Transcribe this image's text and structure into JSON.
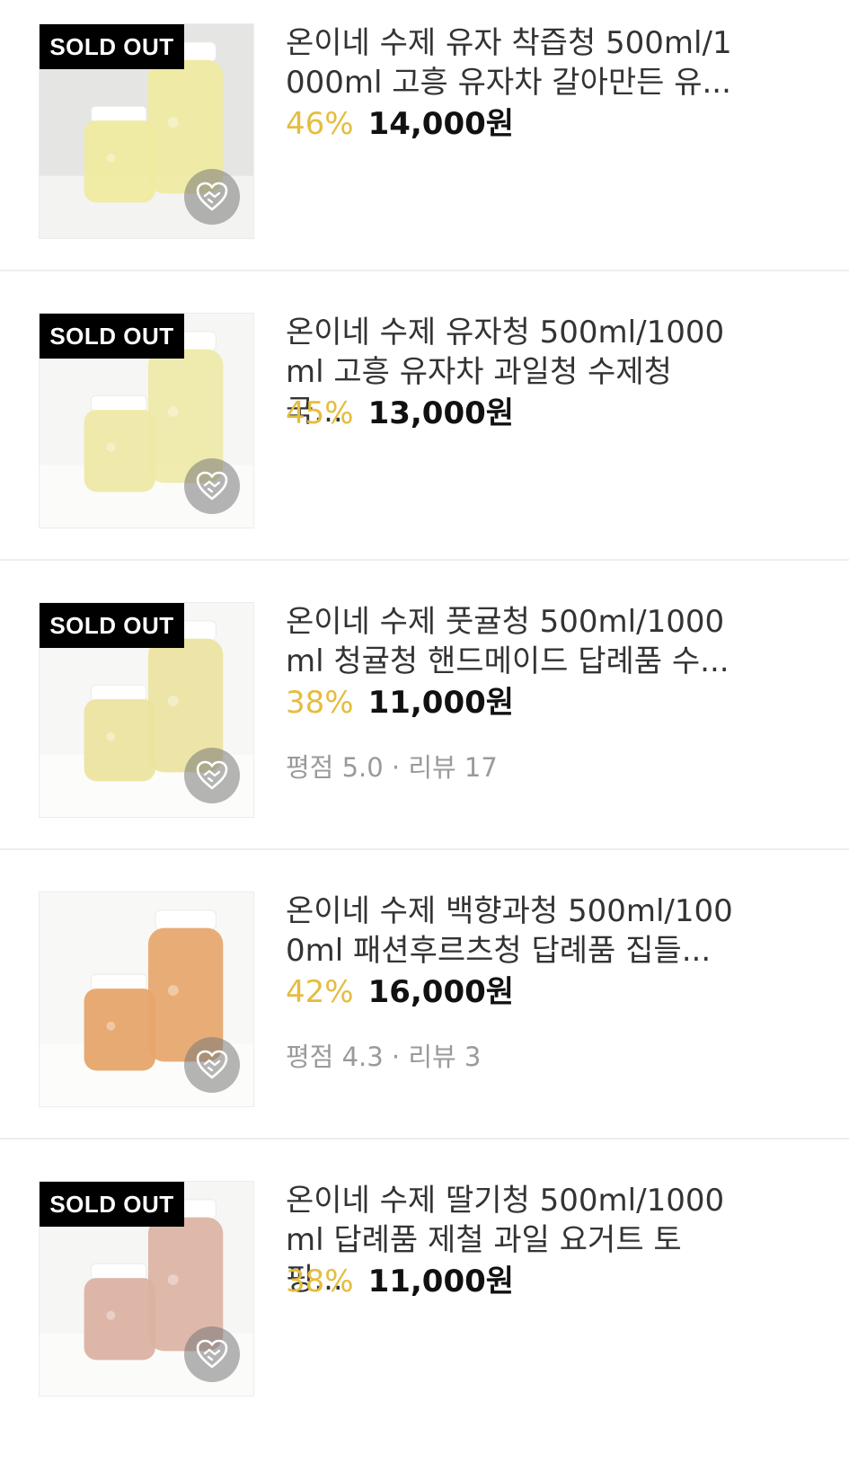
{
  "products": [
    {
      "title_line1": "온이네 수제 유자 착즙청 500ml/1",
      "title_line2": "000ml 고흥 유자차 갈아만든 유...",
      "discount": "46%",
      "price": "14,000원",
      "sold_out": true,
      "sold_out_label": "SOLD OUT",
      "rating": null,
      "jar_color": "#e8df6f",
      "bg_color": "#d8d8d6"
    },
    {
      "title_line1": "온이네 수제 유자청 500ml/1000",
      "title_line2": "ml 고흥 유자차 과일청 수제청 국...",
      "discount": "45%",
      "price": "13,000원",
      "sold_out": true,
      "sold_out_label": "SOLD OUT",
      "rating": null,
      "jar_color": "#e6dd78",
      "bg_color": "#f1f1ef"
    },
    {
      "title_line1": "온이네 수제 풋귤청 500ml/1000",
      "title_line2": "ml 청귤청 핸드메이드 답례품 수...",
      "discount": "38%",
      "price": "11,000원",
      "sold_out": true,
      "sold_out_label": "SOLD OUT",
      "rating": "평점 5.0 · 리뷰 17",
      "jar_color": "#e2d56e",
      "bg_color": "#f3f3f2"
    },
    {
      "title_line1": "온이네 수제 백향과청 500ml/100",
      "title_line2": "0ml 패션후르츠청 답례품 집들...",
      "discount": "42%",
      "price": "16,000원",
      "sold_out": false,
      "sold_out_label": "",
      "rating": "평점 4.3 · 리뷰 3",
      "jar_color": "#d9761c",
      "bg_color": "#f4f4f2"
    },
    {
      "title_line1": "온이네 수제 딸기청 500ml/1000",
      "title_line2": "ml 답례품 제철 과일 요거트 토핑...",
      "discount": "38%",
      "price": "11,000원",
      "sold_out": true,
      "sold_out_label": "SOLD OUT",
      "rating": null,
      "jar_color": "#c98a72",
      "bg_color": "#f2f1ef"
    }
  ],
  "colors": {
    "discount": "#e5bd3f",
    "price": "#111111",
    "meta": "#9a9a9a",
    "divider": "#eeeeee"
  },
  "icons": {
    "wishlist": "heart-handshake-icon"
  }
}
